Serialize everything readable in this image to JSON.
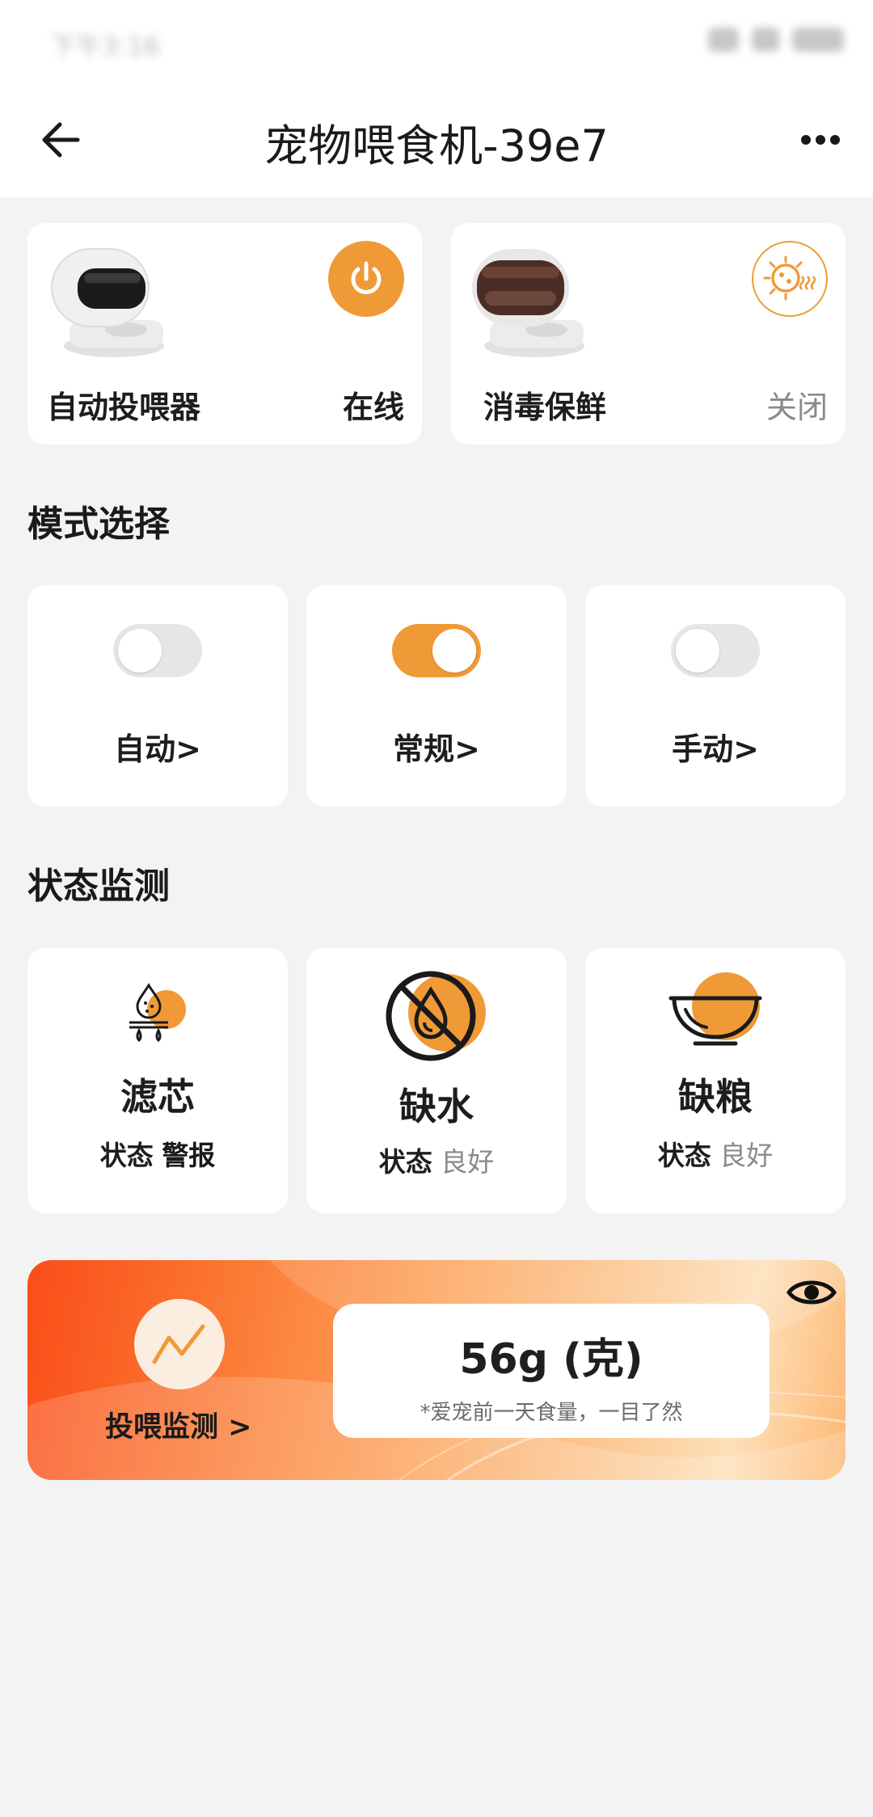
{
  "status_bar": {
    "time": "下午3:16"
  },
  "header": {
    "title": "宠物喂食机-39e7"
  },
  "devices": [
    {
      "name": "自动投喂器",
      "status": "在线"
    },
    {
      "name": "消毒保鲜",
      "status": "关闭"
    }
  ],
  "mode_section": {
    "title": "模式选择",
    "modes": [
      {
        "label": "自动>",
        "enabled": false
      },
      {
        "label": "常规>",
        "enabled": true
      },
      {
        "label": "手动>",
        "enabled": false
      }
    ]
  },
  "status_section": {
    "title": "状态监测",
    "items": [
      {
        "name": "滤芯",
        "key": "状态",
        "value": "警报"
      },
      {
        "name": "缺水",
        "key": "状态",
        "value": "良好"
      },
      {
        "name": "缺粮",
        "key": "状态",
        "value": "良好"
      }
    ]
  },
  "feeding": {
    "link_label": "投喂监测 >",
    "amount": "56g (克)",
    "note": "*爱宠前一天食量，一目了然"
  },
  "colors": {
    "accent": "#f09a37",
    "background": "#f3f3f4"
  }
}
